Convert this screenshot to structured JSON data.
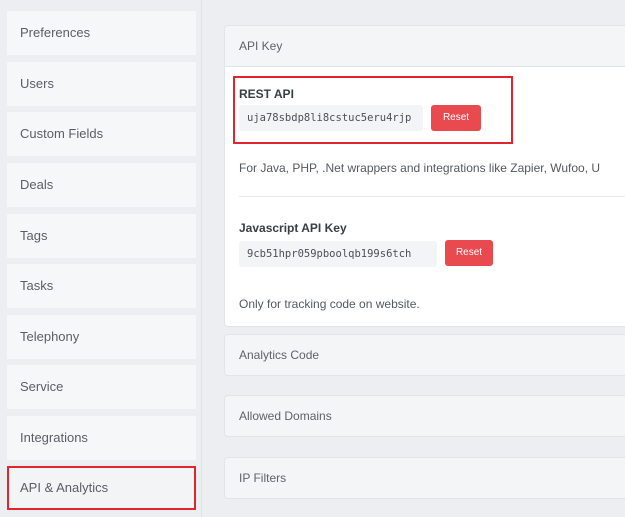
{
  "sidebar": {
    "items": [
      {
        "label": "Preferences",
        "active": false
      },
      {
        "label": "Users",
        "active": false
      },
      {
        "label": "Custom Fields",
        "active": false
      },
      {
        "label": "Deals",
        "active": false
      },
      {
        "label": "Tags",
        "active": false
      },
      {
        "label": "Tasks",
        "active": false
      },
      {
        "label": "Telephony",
        "active": false
      },
      {
        "label": "Service",
        "active": false
      },
      {
        "label": "Integrations",
        "active": false
      },
      {
        "label": "API & Analytics",
        "active": true
      }
    ]
  },
  "main": {
    "api_key_panel": {
      "title": "API Key",
      "rest_api": {
        "title": "REST API",
        "key": "uja78sbdp8li8cstuc5eru4rjp",
        "reset_label": "Reset",
        "description": "For Java, PHP, .Net wrappers and integrations like Zapier, Wufoo, U"
      },
      "js_api": {
        "title": "Javascript API Key",
        "key": "9cb51hpr059pboolqb199s6tch",
        "reset_label": "Reset",
        "description": "Only for tracking code on website."
      }
    },
    "panels": [
      {
        "title": "Analytics Code"
      },
      {
        "title": "Allowed Domains"
      },
      {
        "title": "IP Filters"
      }
    ]
  },
  "colors": {
    "highlight": "#e0262c",
    "reset_button": "#e84a50",
    "background": "#eceef1"
  }
}
